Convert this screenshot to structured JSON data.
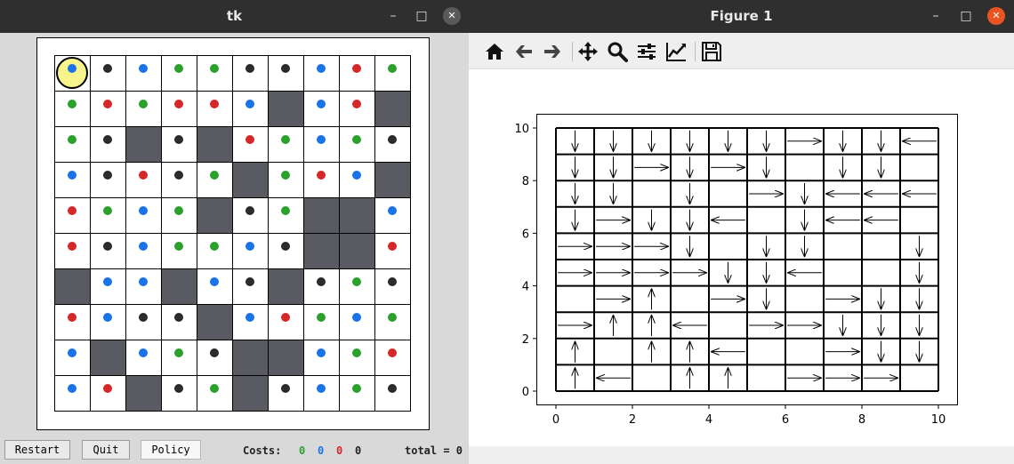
{
  "tk_window": {
    "title": "tk",
    "controls": {
      "minimize": "–",
      "maximize": "□",
      "close": "✕"
    },
    "grid_rows": [
      [
        "b",
        "k",
        "b",
        "g",
        "g",
        "k",
        "k",
        "b",
        "r",
        "g"
      ],
      [
        "g",
        "r",
        "g",
        "r",
        "r",
        "b",
        "W",
        "b",
        "r",
        "W"
      ],
      [
        "g",
        "k",
        "W",
        "k",
        "W",
        "r",
        "g",
        "b",
        "g",
        "k"
      ],
      [
        "b",
        "k",
        "r",
        "k",
        "g",
        "W",
        "g",
        "r",
        "b",
        "W"
      ],
      [
        "r",
        "g",
        "b",
        "g",
        "W",
        "k",
        "g",
        "W",
        "W",
        "b"
      ],
      [
        "r",
        "k",
        "b",
        "g",
        "g",
        "b",
        "k",
        "W",
        "W",
        "r"
      ],
      [
        "W",
        "b",
        "b",
        "W",
        "b",
        "k",
        "W",
        "k",
        "g",
        "k"
      ],
      [
        "r",
        "b",
        "k",
        "k",
        "W",
        "b",
        "r",
        "g",
        "b",
        "g"
      ],
      [
        "b",
        "W",
        "b",
        "g",
        "k",
        "W",
        "W",
        "b",
        "g",
        "r"
      ],
      [
        "b",
        "r",
        "W",
        "k",
        "g",
        "W",
        "k",
        "b",
        "g",
        "k"
      ]
    ],
    "agent": {
      "row": 0,
      "col": 0,
      "color": "#f7f48b"
    },
    "colors": {
      "b": "#1a73e8",
      "k": "#2b2b2b",
      "g": "#2ca02c",
      "r": "#d62728",
      "wall": "#5a5a62"
    },
    "buttons": {
      "restart": "Restart",
      "quit": "Quit",
      "policy": "Policy"
    },
    "costs": {
      "label": "Costs:",
      "green": "0",
      "blue": "0",
      "red": "0",
      "black": "0",
      "total": "total = 0"
    }
  },
  "figure_window": {
    "title": "Figure 1",
    "controls": {
      "minimize": "–",
      "maximize": "□",
      "close": "✕"
    },
    "toolbar": [
      "home-icon",
      "back-icon",
      "forward-icon",
      "pan-icon",
      "zoom-icon",
      "configure-icon",
      "edit-curves-icon",
      "save-icon"
    ]
  },
  "chart_data": {
    "type": "quiver",
    "xlim": [
      0,
      10
    ],
    "ylim": [
      0,
      10
    ],
    "x_ticks": [
      0,
      2,
      4,
      6,
      8,
      10
    ],
    "y_ticks": [
      0,
      2,
      4,
      6,
      8,
      10
    ],
    "grid": "on",
    "policy_rows_top_to_bottom": [
      [
        "D",
        "D",
        "D",
        "D",
        "D",
        "D",
        "R",
        "D",
        "D",
        "L"
      ],
      [
        "D",
        "D",
        "R",
        "D",
        "R",
        "D",
        "",
        "D",
        "D",
        ""
      ],
      [
        "D",
        "D",
        "",
        "D",
        "",
        "R",
        "D",
        "L",
        "L",
        "L"
      ],
      [
        "D",
        "R",
        "D",
        "D",
        "L",
        "",
        "D",
        "L",
        "L",
        ""
      ],
      [
        "R",
        "R",
        "R",
        "D",
        "",
        "D",
        "D",
        "",
        "",
        "D"
      ],
      [
        "R",
        "R",
        "R",
        "R",
        "D",
        "D",
        "L",
        "",
        "",
        "D"
      ],
      [
        "",
        "R",
        "U",
        "",
        "R",
        "D",
        "",
        "R",
        "D",
        "D"
      ],
      [
        "R",
        "U",
        "U",
        "L",
        "",
        "R",
        "R",
        "D",
        "D",
        "D"
      ],
      [
        "U",
        "",
        "U",
        "U",
        "L",
        "",
        "",
        "R",
        "D",
        "D"
      ],
      [
        "U",
        "L",
        "",
        "U",
        "U",
        "",
        "R",
        "R",
        "R",
        ""
      ]
    ]
  }
}
